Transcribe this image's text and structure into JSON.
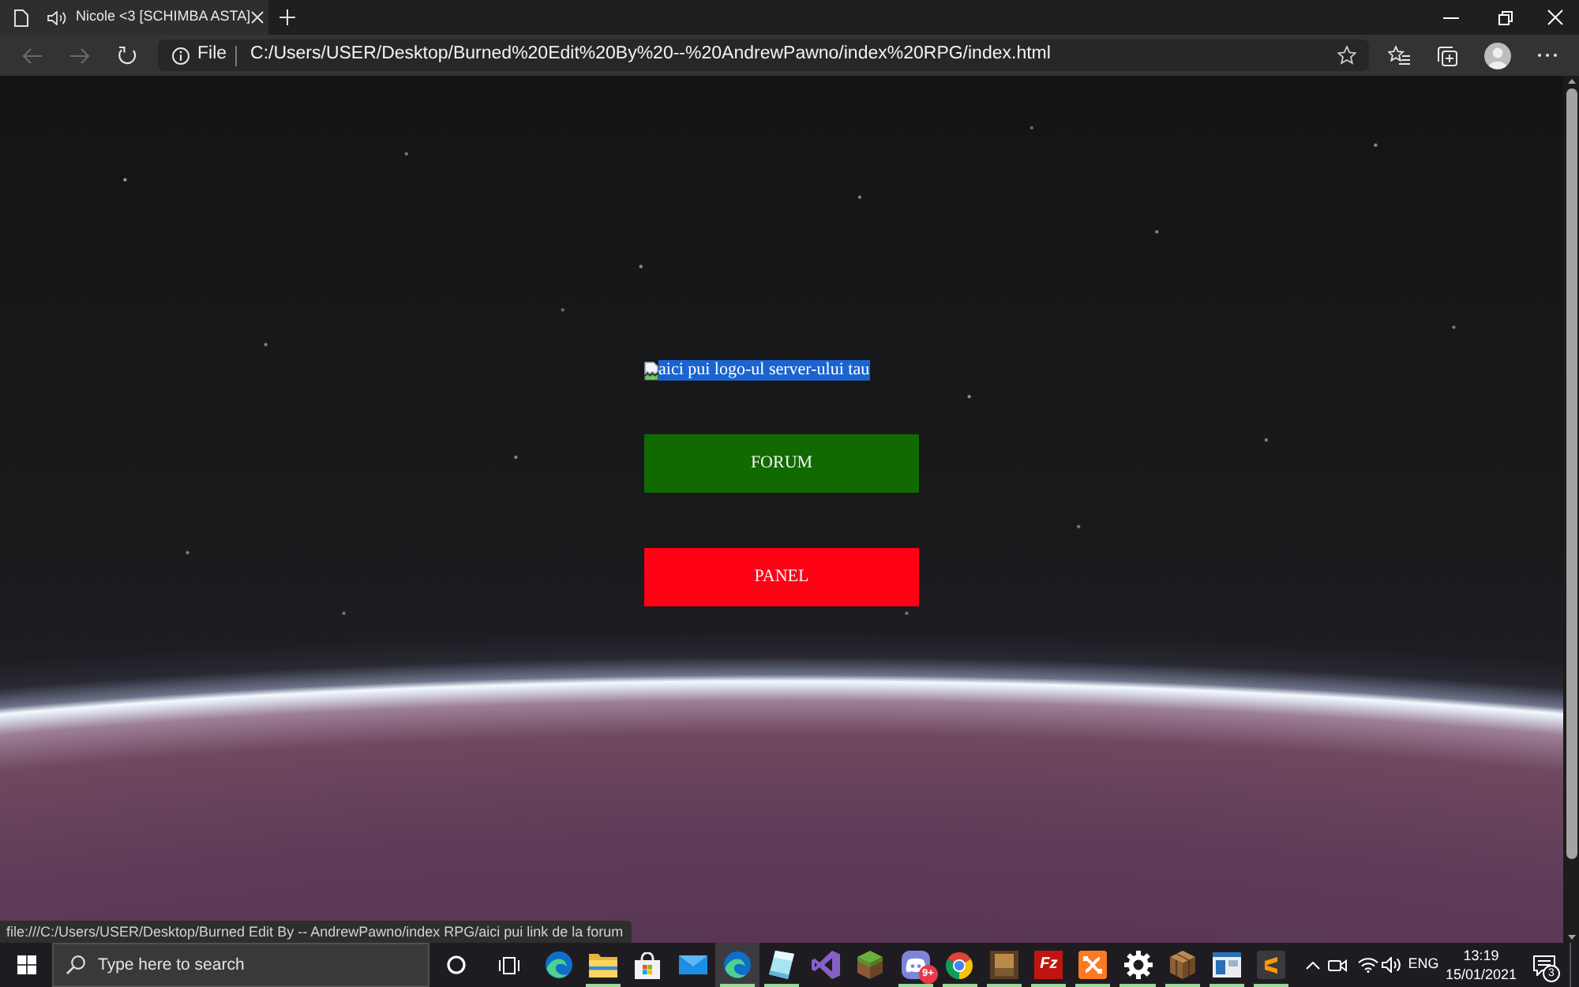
{
  "browser": {
    "tabs": [
      {
        "title": "Nicole <3 [SCHIMBA ASTA]",
        "selected": true,
        "audio_playing": true
      }
    ],
    "navigation": {
      "back": {
        "disabled": true
      },
      "forward": {
        "disabled": true
      }
    },
    "address_bar": {
      "scheme": "File",
      "url": "C:/Users/USER/Desktop/Burned%20Edit%20By%20--%20AndrewPawno/index%20RPG/index.html"
    }
  },
  "page": {
    "logo_alt_text": "aici pui logo-ul server-ului tau",
    "logo_alt_text_selected": true,
    "buttons": [
      {
        "label": "FORUM",
        "color": "#116a00"
      },
      {
        "label": "PANEL",
        "color": "#ff0015"
      }
    ]
  },
  "status_bar": {
    "link": "file:///C:/Users/USER/Desktop/Burned Edit By -- AndrewPawno/index RPG/aici pui link de la forum"
  },
  "taskbar": {
    "search": {
      "placeholder": "Type here to search"
    },
    "apps": [
      {
        "kind": "swirl",
        "running": false,
        "selected": false
      },
      {
        "kind": "folder",
        "running": true,
        "selected": false
      },
      {
        "kind": "bag",
        "running": false,
        "selected": false
      },
      {
        "kind": "envelope",
        "running": false,
        "selected": false
      },
      {
        "kind": "swirl",
        "running": true,
        "selected": true
      },
      {
        "kind": "slanted-tile",
        "running": true,
        "selected": false
      },
      {
        "kind": "ribbon",
        "running": false,
        "selected": false
      },
      {
        "kind": "grass-block",
        "running": false,
        "selected": false
      },
      {
        "kind": "controller-face",
        "running": true,
        "selected": false,
        "badge": "9+"
      },
      {
        "kind": "tricolor-circle",
        "running": true,
        "selected": false
      },
      {
        "kind": "picture-tile",
        "running": true,
        "selected": false
      },
      {
        "kind": "letter-tile",
        "running": true,
        "selected": false,
        "glyph": "Fz"
      },
      {
        "kind": "knot-tile",
        "running": true,
        "selected": false
      },
      {
        "kind": "gear",
        "running": true,
        "selected": false
      },
      {
        "kind": "crate",
        "running": true,
        "selected": false
      },
      {
        "kind": "window",
        "running": true,
        "selected": false
      },
      {
        "kind": "stripes-tile",
        "running": true,
        "selected": false
      }
    ],
    "tray": {
      "language": "ENG",
      "time": "13:19",
      "date": "15/01/2021",
      "notification_count": "3"
    }
  }
}
